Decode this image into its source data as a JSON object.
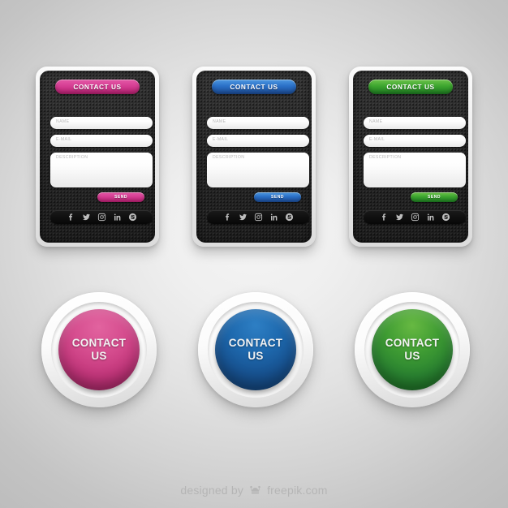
{
  "background": {
    "center_color": "#f4f4f4",
    "edge_color": "#bdbdbd"
  },
  "cards": [
    {
      "accent": "#d63f94",
      "theme": "pink",
      "header_label": "CONTACT US",
      "fields": [
        {
          "name": "name",
          "placeholder": "NAME"
        },
        {
          "name": "email",
          "placeholder": "E-MAIL"
        },
        {
          "name": "description",
          "placeholder": "DESCRIPTION"
        }
      ],
      "send_label": "SEND",
      "social": [
        "facebook-icon",
        "twitter-icon",
        "instagram-icon",
        "linkedin-icon",
        "skype-icon"
      ]
    },
    {
      "accent": "#2a6fc6",
      "theme": "blue",
      "header_label": "CONTACT US",
      "fields": [
        {
          "name": "name",
          "placeholder": "NAME"
        },
        {
          "name": "email",
          "placeholder": "E-MAIL"
        },
        {
          "name": "description",
          "placeholder": "DESCRIPTION"
        }
      ],
      "send_label": "SEND",
      "social": [
        "facebook-icon",
        "twitter-icon",
        "instagram-icon",
        "linkedin-icon",
        "skype-icon"
      ]
    },
    {
      "accent": "#3ca52f",
      "theme": "green",
      "header_label": "CONTACT US",
      "fields": [
        {
          "name": "name",
          "placeholder": "NAME"
        },
        {
          "name": "email",
          "placeholder": "E-MAIL"
        },
        {
          "name": "description",
          "placeholder": "DESCRIPTION"
        }
      ],
      "send_label": "SEND",
      "social": [
        "facebook-icon",
        "twitter-icon",
        "instagram-icon",
        "linkedin-icon",
        "skype-icon"
      ]
    }
  ],
  "round_buttons": [
    {
      "theme": "pink",
      "color": "#c13479",
      "line1": "CONTACT",
      "line2": "US"
    },
    {
      "theme": "blue",
      "color": "#17518f",
      "line1": "CONTACT",
      "line2": "US"
    },
    {
      "theme": "green",
      "color": "#2a8331",
      "line1": "CONTACT",
      "line2": "US"
    }
  ],
  "footer": {
    "prefix": "designed by",
    "logo": "freepik-crown-icon",
    "brand": "freepik.com"
  }
}
